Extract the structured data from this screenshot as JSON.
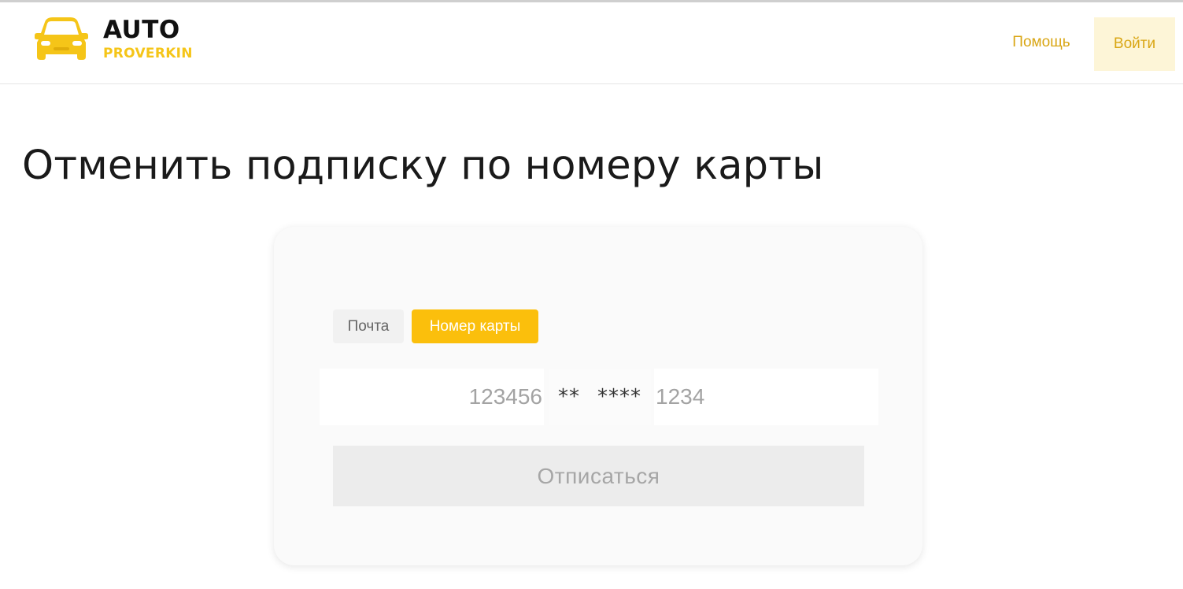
{
  "header": {
    "logo_primary": "AUTO",
    "logo_secondary": "PROVERKIN",
    "help_label": "Помощь",
    "login_label": "Войти"
  },
  "page": {
    "title": "Отменить подписку по номеру карты"
  },
  "form": {
    "tabs": [
      {
        "label": "Почта",
        "active": false
      },
      {
        "label": "Номер карты",
        "active": true
      }
    ],
    "card_first_placeholder": "123456",
    "card_mask_group_a": "**",
    "card_mask_group_b": "****",
    "card_last_placeholder": "1234",
    "submit_label": "Отписаться"
  },
  "colors": {
    "accent": "#fbbf0c",
    "accent_text": "#d9a614",
    "login_bg": "#fdf5d7"
  },
  "icons": {
    "logo": "car-icon"
  }
}
